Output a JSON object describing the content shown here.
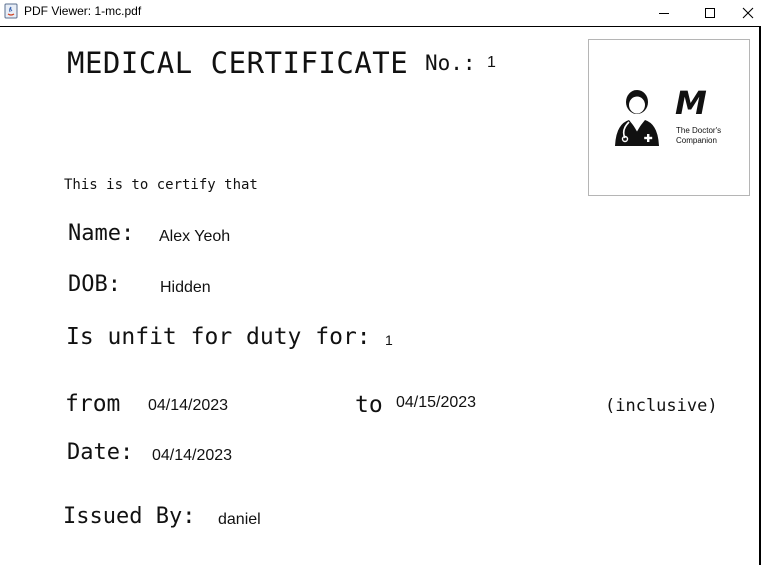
{
  "window": {
    "title": "PDF Viewer: 1-mc.pdf"
  },
  "certificate": {
    "title": "MEDICAL CERTIFICATE",
    "number_label": "No.:",
    "number_value": "1",
    "logo": {
      "letter": "M",
      "tagline_line1": "The Doctor's",
      "tagline_line2": "Companion"
    },
    "intro": "This is to certify that",
    "name_label": "Name:",
    "name_value": "Alex Yeoh",
    "dob_label": "DOB:",
    "dob_value": "Hidden",
    "unfit_label": "Is unfit for duty for:",
    "unfit_value": "1",
    "from_label": "from",
    "from_value": "04/14/2023",
    "to_label": "to",
    "to_value": "04/15/2023",
    "inclusive_label": "(inclusive)",
    "date_label": "Date:",
    "date_value": "04/14/2023",
    "issued_by_label": "Issued By:",
    "issued_by_value": "daniel"
  }
}
